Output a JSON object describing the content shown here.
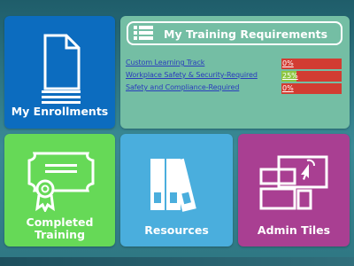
{
  "tiles": {
    "enrollments": {
      "label": "My Enrollments",
      "icon": "document-icon",
      "color": "#0c6cbf"
    },
    "requirements": {
      "title": "My Training Requirements",
      "icon": "list-icon",
      "color": "#74bea4",
      "items": [
        {
          "label": "Custom Learning Track",
          "percent_label": "0%",
          "percent": 0
        },
        {
          "label": "Workplace Safety & Security-Required",
          "percent_label": "25%",
          "percent": 25
        },
        {
          "label": "Safety and Compliance-Required",
          "percent_label": "0%",
          "percent": 0
        }
      ]
    },
    "completed": {
      "label_line1": "Completed",
      "label_line2": "Training",
      "icon": "certificate-icon",
      "color": "#66d957"
    },
    "resources": {
      "label": "Resources",
      "icon": "binders-icon",
      "color": "#4aaedd"
    },
    "admin": {
      "label": "Admin Tiles",
      "icon": "screen-click-icon",
      "color": "#a93f92"
    }
  },
  "colors": {
    "progress_incomplete": "#d23c32",
    "progress_complete": "#8dc63f",
    "link": "#2a3cbd"
  }
}
